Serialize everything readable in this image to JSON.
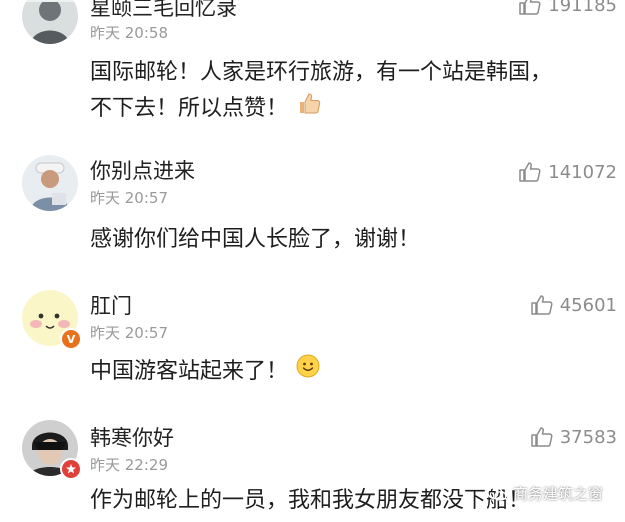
{
  "comments": [
    {
      "username": "星颐三毛回忆录",
      "time": "昨天 20:58",
      "likes": "191185",
      "text_lines": [
        "国际邮轮！人家是环行旅游，有一个站是韩国，",
        "不下去！所以点赞！"
      ],
      "emoji": "thumbs-up-emoji"
    },
    {
      "username": "你别点进来",
      "time": "昨天 20:57",
      "likes": "141072",
      "text_lines": [
        "感谢你们给中国人长脸了，谢谢！"
      ]
    },
    {
      "username": "肛门",
      "time": "昨天 20:57",
      "likes": "45601",
      "text_lines": [
        "中国游客站起来了！"
      ],
      "emoji": "smile-emoji",
      "badge": "V",
      "badge_color": "#e8721c"
    },
    {
      "username": "韩寒你好",
      "time": "昨天 22:29",
      "likes": "37583",
      "text_lines": [
        "作为邮轮上的一员，我和我女朋友都没下船！"
      ],
      "badge_color": "#e0403a"
    }
  ],
  "watermark": {
    "text": "商务建筑之窗",
    "icon": "wechat-icon"
  },
  "colors": {
    "like_gray": "#8c8c8c",
    "time_gray": "#9a9a9a",
    "text": "#1e1e1e"
  }
}
